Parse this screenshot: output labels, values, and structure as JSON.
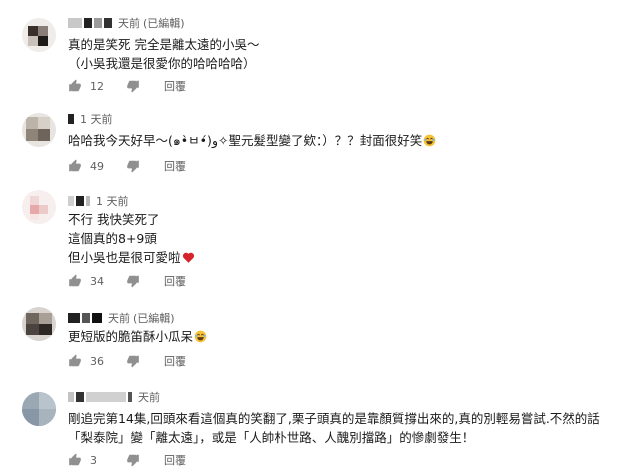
{
  "comments": [
    {
      "time": "天前",
      "edited": "(已編輯)",
      "lines": [
        "真的是笑死 完全是離太遠的小吳～",
        "（小吳我還是很愛你的哈哈哈哈）"
      ],
      "likes": "12",
      "reply": "回覆",
      "avatar_colors": [
        "#3a2f2a",
        "#8a7f78",
        "#1e1a18",
        "#c9c0ba"
      ]
    },
    {
      "time": "1 天前",
      "edited": "",
      "lines": [
        "哈哈我今天好早～(๑•̀ㅂ•́)و✧聖元髮型變了欸：）？？封面很好笑"
      ],
      "likes": "49",
      "reply": "回覆",
      "avatar_colors": [
        "#bdb3a8",
        "#6e645c",
        "#d7d0c9",
        "#8f8478"
      ]
    },
    {
      "time": "1 天前",
      "edited": "",
      "lines": [
        "不行 我快笑死了",
        "這個真的8+9頭",
        "但小吳也是很可愛啦"
      ],
      "likes": "34",
      "reply": "回覆",
      "avatar_colors": [
        "#f0d7d7",
        "#e6a8a8",
        "#f6e6e6",
        "#eccaca"
      ]
    },
    {
      "time": "天前",
      "edited": "(已編輯)",
      "lines": [
        "更短版的脆笛酥小瓜呆"
      ],
      "likes": "36",
      "reply": "回覆",
      "avatar_colors": [
        "#6f665e",
        "#2e2824",
        "#a89f97",
        "#4b433d"
      ]
    },
    {
      "time": "天前",
      "edited": "",
      "lines": [
        "剛追完第14集,回頭來看這個真的笑翻了,栗子頭真的是靠顏質撐出來的,真的別輕易嘗試.不然的話「梨泰院」變「離太遠」，或是「人帥朴世路、人醜別擋路」的慘劇發生！"
      ],
      "likes": "3",
      "reply": "回覆",
      "avatar_colors": [
        "#9aa8b4",
        "#b8c3cc",
        "#8797a5",
        "#a7b3bd"
      ]
    }
  ],
  "icons": {
    "like": "thumbs-up-icon",
    "dislike": "thumbs-down-icon",
    "laugh": "laughing-emoji-icon",
    "heart": "heart-icon"
  },
  "colors": {
    "meta": "#606060",
    "text": "#1a1a1a",
    "heart": "#d6232b",
    "emoji": "#f6c236"
  }
}
